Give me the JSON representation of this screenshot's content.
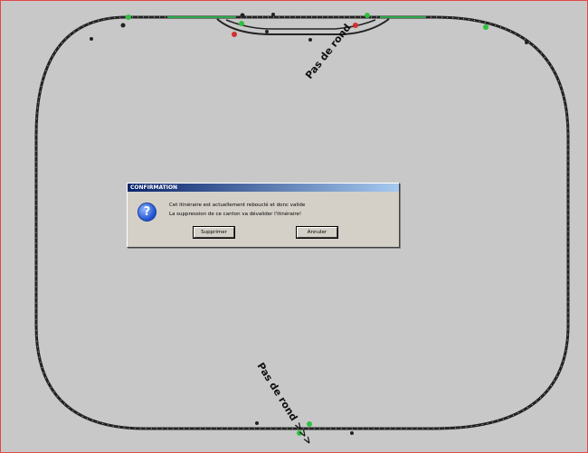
{
  "dialog": {
    "title": "CONFIRMATION",
    "line1": "Cet itinéraire est actuellement rebouclé et donc valide",
    "line2": "La suppression de ce canton va dévalider l'itinéraire!",
    "confirm_label": "Supprimer",
    "cancel_label": "Annuler",
    "icon": "question-icon"
  },
  "layout_labels": {
    "top_label": "Pas de rond",
    "bottom_label": "Pas de rond >>>"
  },
  "colors": {
    "background": "#c8c8c8",
    "border": "#e04848",
    "track": "#222222",
    "track_active": "#2aa84a",
    "signal_green": "#30c040",
    "signal_red": "#d03030"
  }
}
